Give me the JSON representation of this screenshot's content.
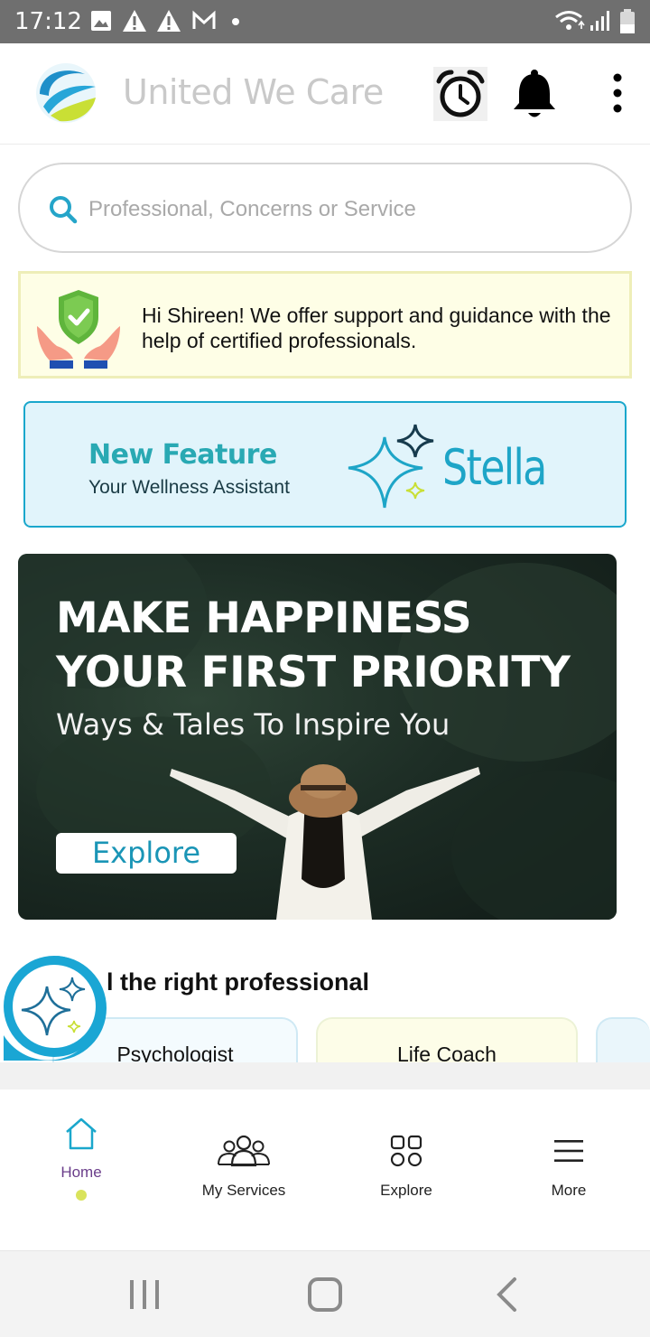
{
  "status_bar": {
    "time": "17:12"
  },
  "header": {
    "app_name": "United We Care"
  },
  "search": {
    "placeholder": "Professional, Concerns or Service"
  },
  "greeting": {
    "text": "Hi Shireen! We offer support and guidance with the help of certified professionals."
  },
  "stella_banner": {
    "feature_label": "New Feature",
    "subtitle": "Your Wellness Assistant",
    "name": "Stella"
  },
  "hero": {
    "line1": "MAKE HAPPINESS",
    "line2": "YOUR FIRST PRIORITY",
    "subtitle": "Ways & Tales To Inspire You",
    "button_label": "Explore"
  },
  "professionals": {
    "title": "l the right professional",
    "cards": [
      "Psychologist",
      "Life Coach"
    ]
  },
  "bottom_nav": {
    "items": [
      {
        "label": "Home",
        "icon": "home-icon",
        "active": true
      },
      {
        "label": "My Services",
        "icon": "users-icon"
      },
      {
        "label": "Explore",
        "icon": "grid-icon"
      },
      {
        "label": "More",
        "icon": "hamburger-icon"
      }
    ]
  },
  "colors": {
    "accent": "#1ea5c7",
    "active_nav": "#6a3d8a",
    "greeting_bg": "#fefee6"
  }
}
